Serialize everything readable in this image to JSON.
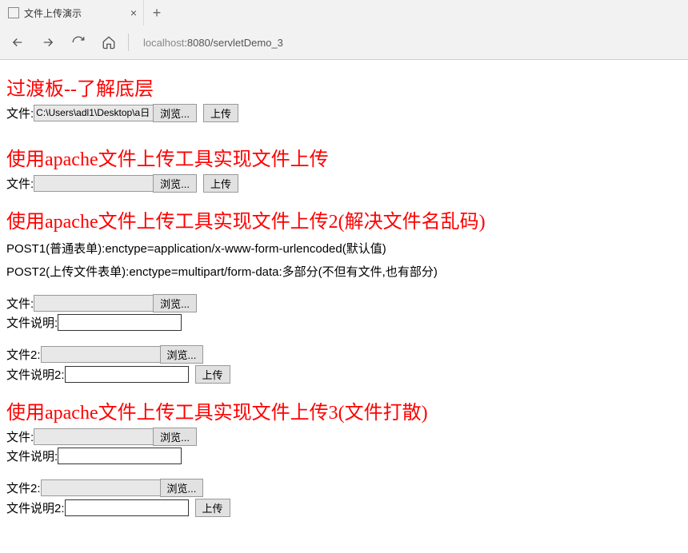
{
  "browser": {
    "tab_title": "文件上传演示",
    "url_host": "localhost",
    "url_port": ":8080",
    "url_path": "/servletDemo_3"
  },
  "buttons": {
    "browse": "浏览...",
    "upload": "上传"
  },
  "section1": {
    "heading": "过渡板--了解底层",
    "file_label": "文件:",
    "file_value": "C:\\Users\\adl1\\Desktop\\a日"
  },
  "section2": {
    "heading": "使用apache文件上传工具实现文件上传",
    "file_label": "文件:"
  },
  "section3": {
    "heading": "使用apache文件上传工具实现文件上传2(解决文件名乱码)",
    "post1": "POST1(普通表单):enctype=application/x-www-form-urlencoded(默认值)",
    "post2": "POST2(上传文件表单):enctype=multipart/form-data:多部分(不但有文件,也有部分)",
    "file_label": "文件:",
    "desc_label": "文件说明:",
    "file2_label": "文件2:",
    "desc2_label": "文件说明2:"
  },
  "section4": {
    "heading": "使用apache文件上传工具实现文件上传3(文件打散)",
    "file_label": "文件:",
    "desc_label": "文件说明:",
    "file2_label": "文件2:",
    "desc2_label": "文件说明2:"
  }
}
